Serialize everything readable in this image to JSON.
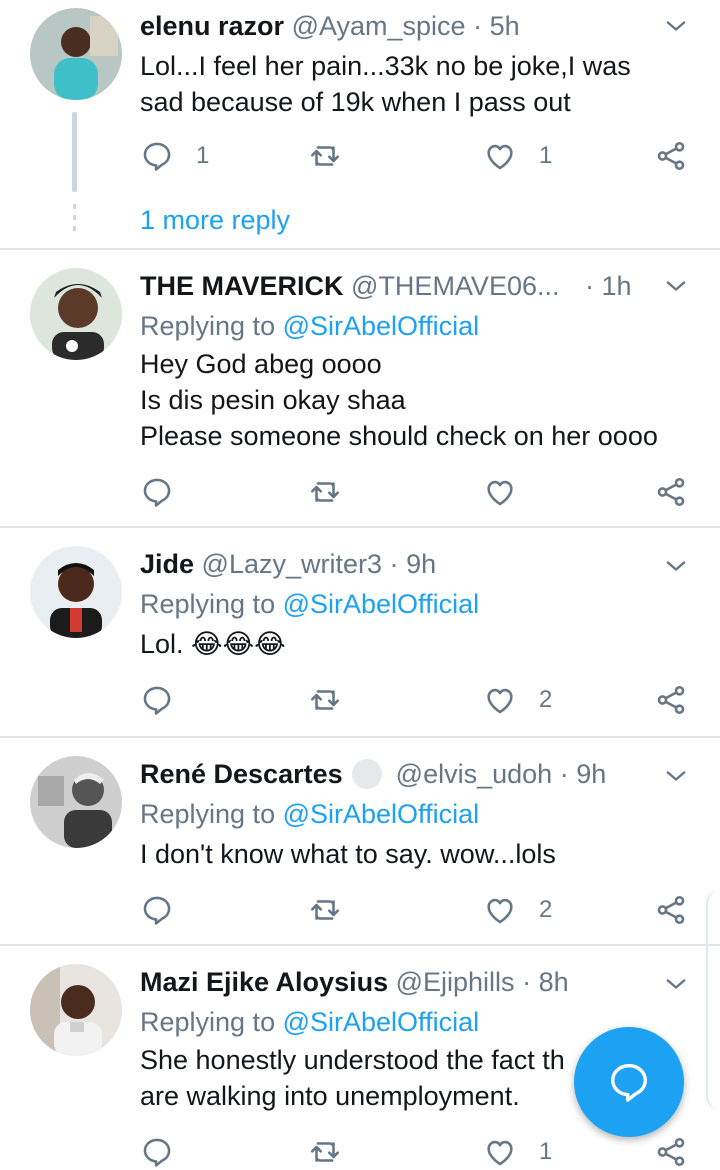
{
  "colors": {
    "accent": "#1da1f2",
    "muted": "#657786",
    "text": "#14171a",
    "divider": "#e1e8ed"
  },
  "icons": {
    "reply": "speech-bubble-icon",
    "retweet": "retweet-icon",
    "like": "heart-icon",
    "share": "share-icon",
    "menu": "chevron-down-icon",
    "compose": "compose-reply-icon"
  },
  "tweets": [
    {
      "name": "elenu razor",
      "handle": "@Ayam_spice",
      "dot": "·",
      "time": "5h",
      "lines": [
        "Lol...I feel her pain...33k no be joke,I was",
        "sad because of 19k when I pass out"
      ],
      "reply_count": "1",
      "retweet_count": "",
      "like_count": "1",
      "more_reply": "1 more reply"
    },
    {
      "name": "THE MAVERICK",
      "handle": "@THEMAVE06...",
      "dot": "·",
      "time": "1h",
      "replying_prefix": "Replying to",
      "replying_to": "@SirAbelOfficial",
      "lines": [
        "Hey God abeg oooo",
        "Is dis pesin okay shaa",
        "Please someone should check on her oooo"
      ],
      "reply_count": "",
      "retweet_count": "",
      "like_count": ""
    },
    {
      "name": "Jide",
      "handle": "@Lazy_writer3",
      "dot": "·",
      "time": "9h",
      "replying_prefix": "Replying to",
      "replying_to": "@SirAbelOfficial",
      "lines": [
        "Lol. 😂😂😂"
      ],
      "reply_count": "",
      "retweet_count": "",
      "like_count": "2"
    },
    {
      "name": "René Descartes",
      "handle": "@elvis_udoh",
      "dot": "·",
      "time": "9h",
      "replying_prefix": "Replying to",
      "replying_to": "@SirAbelOfficial",
      "lines": [
        "I don't know what to say. wow...lols"
      ],
      "reply_count": "",
      "retweet_count": "",
      "like_count": "2"
    },
    {
      "name": "Mazi Ejike Aloysius",
      "handle": "@Ejiphills",
      "dot": "·",
      "time": "8h",
      "replying_prefix": "Replying to",
      "replying_to": "@SirAbelOfficial",
      "lines": [
        "She honestly understood the fact th",
        "are walking into unemployment."
      ],
      "reply_count": "",
      "retweet_count": "",
      "like_count": "1"
    }
  ]
}
